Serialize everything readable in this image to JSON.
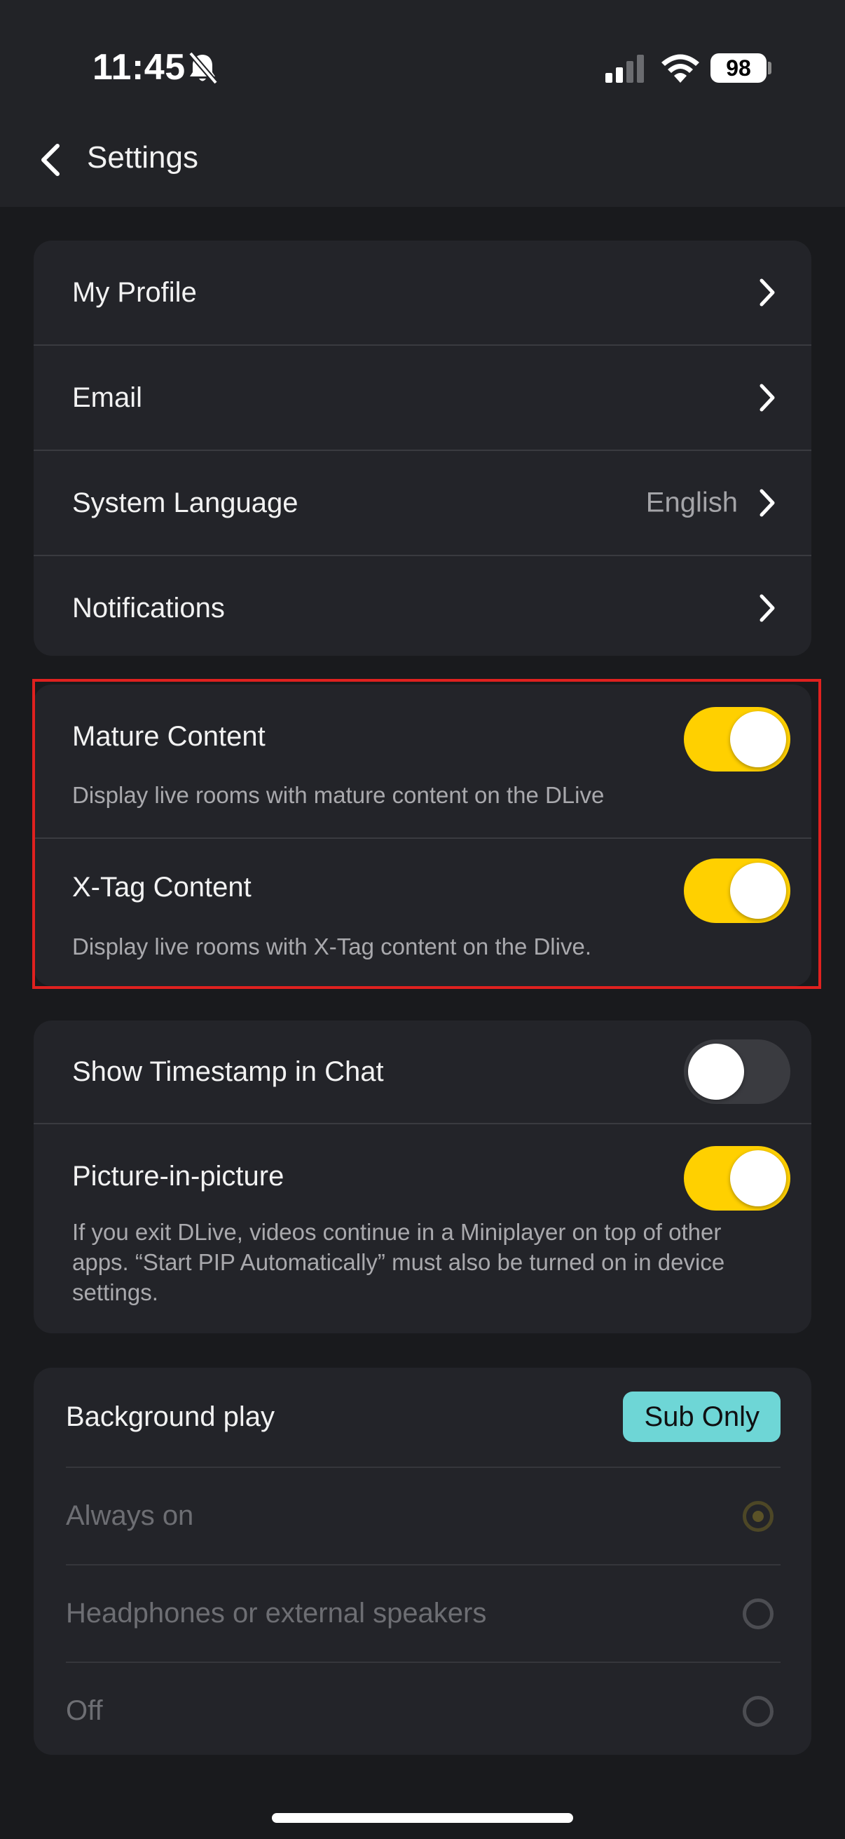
{
  "status_bar": {
    "time": "11:45",
    "battery": "98",
    "icons": [
      "bell-slash-icon",
      "signal-icon",
      "wifi-icon",
      "battery-icon"
    ]
  },
  "header": {
    "back_icon": "chevron-left-icon",
    "title": "Settings"
  },
  "account_section": {
    "items": [
      {
        "label": "My Profile",
        "value": ""
      },
      {
        "label": "Email",
        "value": ""
      },
      {
        "label": "System Language",
        "value": "English"
      },
      {
        "label": "Notifications",
        "value": ""
      }
    ]
  },
  "content_section": {
    "mature": {
      "label": "Mature Content",
      "description": "Display live rooms with mature content on the DLive",
      "enabled": true
    },
    "xtag": {
      "label": "X-Tag Content",
      "description": "Display live rooms with X-Tag content on the Dlive.",
      "enabled": true
    },
    "highlight_color": "#e0211f"
  },
  "playback_section": {
    "timestamp": {
      "label": "Show Timestamp in Chat",
      "enabled": false
    },
    "pip": {
      "label": "Picture-in-picture",
      "description": "If you exit DLive, videos continue in a Miniplayer on top of other apps. “Start PIP Automatically” must also be turned on in device settings.",
      "enabled": true
    }
  },
  "background_play": {
    "title": "Background play",
    "badge": "Sub Only",
    "options": [
      {
        "label": "Always on",
        "selected": true
      },
      {
        "label": "Headphones or external speakers",
        "selected": false
      },
      {
        "label": "Off",
        "selected": false
      }
    ]
  },
  "colors": {
    "toggle_on": "#ffd000",
    "badge": "#6ed6d6",
    "card_bg": "#232429",
    "page_bg": "#191a1d"
  }
}
